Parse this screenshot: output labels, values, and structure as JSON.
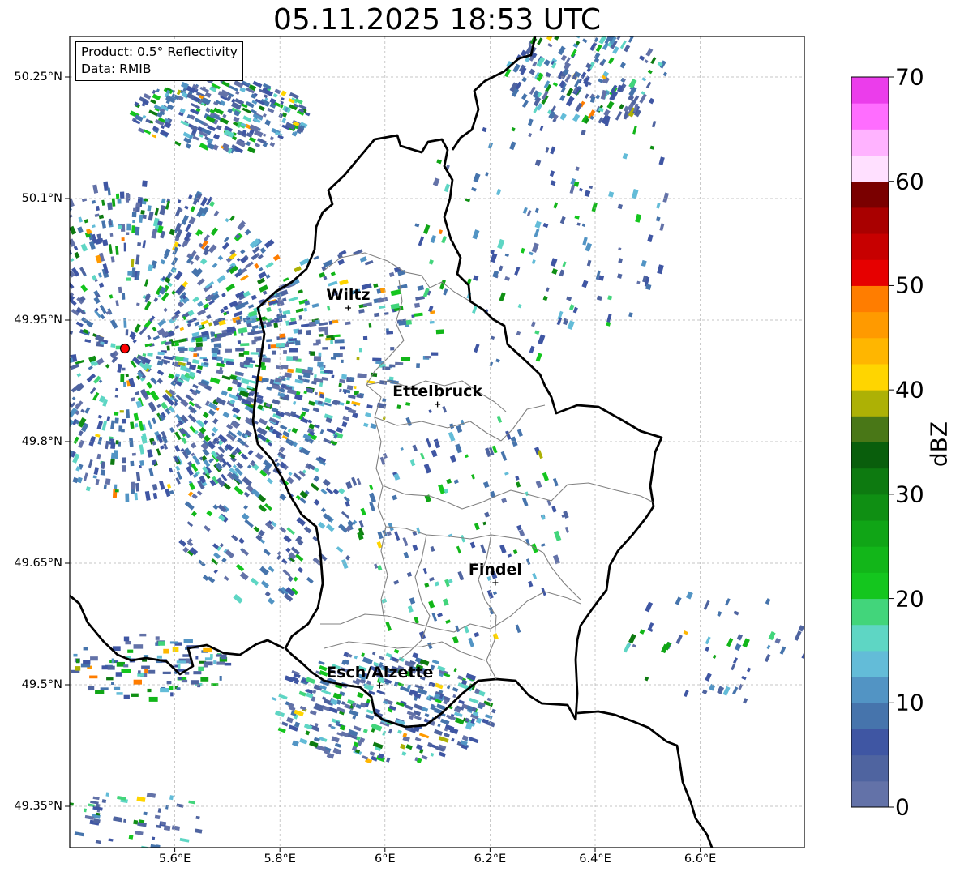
{
  "title": "05.11.2025 18:53 UTC",
  "info": {
    "product": "Product: 0.5° Reflectivity",
    "data": "Data: RMIB"
  },
  "axes": {
    "lat_ticks": [
      {
        "value": 50.25,
        "label": "50.25°N"
      },
      {
        "value": 50.1,
        "label": "50.1°N"
      },
      {
        "value": 49.95,
        "label": "49.95°N"
      },
      {
        "value": 49.8,
        "label": "49.8°N"
      },
      {
        "value": 49.65,
        "label": "49.65°N"
      },
      {
        "value": 49.5,
        "label": "49.5°N"
      },
      {
        "value": 49.35,
        "label": "49.35°N"
      }
    ],
    "lon_ticks": [
      {
        "value": 5.6,
        "label": "5.6°E"
      },
      {
        "value": 5.8,
        "label": "5.8°E"
      },
      {
        "value": 6.0,
        "label": "6°E"
      },
      {
        "value": 6.2,
        "label": "6.2°E"
      },
      {
        "value": 6.4,
        "label": "6.4°E"
      },
      {
        "value": 6.6,
        "label": "6.6°E"
      }
    ]
  },
  "radar_site": {
    "lon": 5.505,
    "lat": 49.915,
    "color": "#ff0000"
  },
  "cities": [
    {
      "name": "Wiltz",
      "lon": 5.93,
      "lat": 49.965
    },
    {
      "name": "Ettelbruck",
      "lon": 6.1,
      "lat": 49.846
    },
    {
      "name": "Findel",
      "lon": 6.21,
      "lat": 49.626
    },
    {
      "name": "Esch/Alzette",
      "lon": 5.99,
      "lat": 49.499
    }
  ],
  "colorbar": {
    "label": "dBZ",
    "ticks": [
      "0",
      "10",
      "20",
      "30",
      "40",
      "50",
      "60",
      "70"
    ],
    "colors": [
      "#6372a8",
      "#4f64a0",
      "#3f56a3",
      "#4674ac",
      "#5294c4",
      "#63bcd8",
      "#5ed6c4",
      "#42d57b",
      "#14c61e",
      "#12b619",
      "#10a516",
      "#0f8f13",
      "#0d7a10",
      "#095e0c",
      "#497717",
      "#adb105",
      "#ffd500",
      "#ffb600",
      "#ff9a00",
      "#ff7d00",
      "#e60000",
      "#c70000",
      "#a90000",
      "#7a0000",
      "#ffe0ff",
      "#ffb3ff",
      "#ff6dff",
      "#eb3deb"
    ]
  }
}
